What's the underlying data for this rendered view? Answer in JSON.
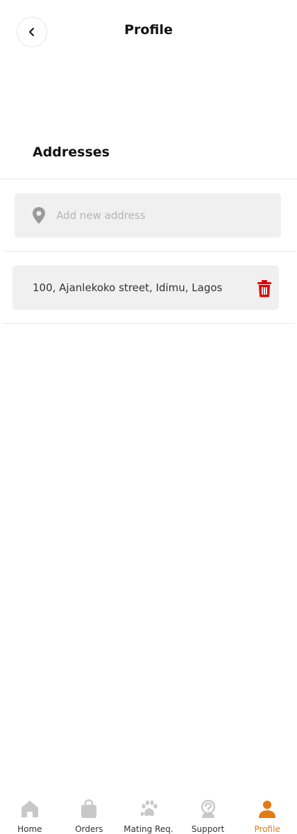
{
  "header": {
    "title": "Profile",
    "back_icon": "chevron-left-icon"
  },
  "addresses": {
    "section_title": "Addresses",
    "add_placeholder": "Add new address",
    "add_icon": "map-pin-icon",
    "items": [
      {
        "text": "100, Ajanlekoko street, Idimu, Lagos",
        "delete_icon": "trash-icon"
      }
    ]
  },
  "bottom_nav": {
    "items": [
      {
        "label": "Home",
        "icon": "home-icon"
      },
      {
        "label": "Orders",
        "icon": "shopping-bag-icon"
      },
      {
        "label": "Mating Req.",
        "icon": "paw-icon"
      },
      {
        "label": "Support",
        "icon": "support-icon"
      },
      {
        "label": "Profile",
        "icon": "user-icon",
        "active": true
      }
    ]
  },
  "colors": {
    "accent": "#e67a12",
    "inactive_icon": "#c8c8c8",
    "delete": "#e10000",
    "field_bg": "#f0f0f0"
  }
}
